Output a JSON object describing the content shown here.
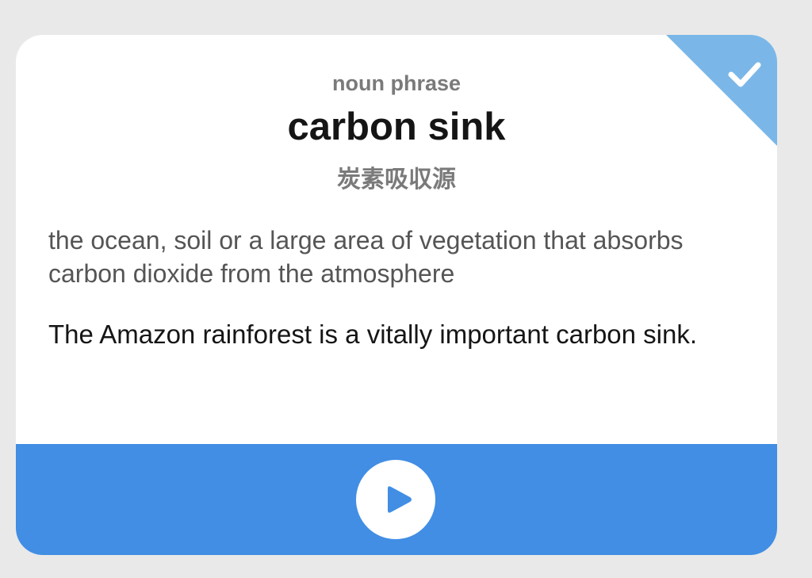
{
  "card": {
    "part_of_speech": "noun phrase",
    "headword": "carbon sink",
    "translation": "炭素吸収源",
    "definition": "the ocean, soil or a large area of vegetation that absorbs carbon dioxide from the atmosphere",
    "example": "The Amazon rainforest is a vitally important carbon sink.",
    "status_icon": "checkmark-icon",
    "status_color": "#7ab7e8"
  },
  "audio": {
    "play_icon": "play-icon",
    "bar_color": "#418ee4"
  }
}
